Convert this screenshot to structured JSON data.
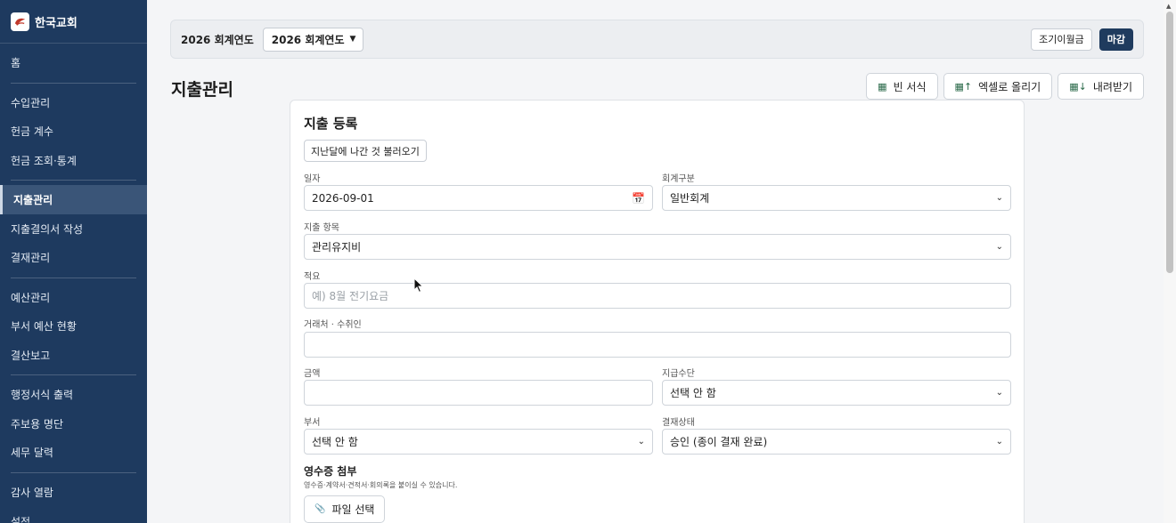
{
  "brand": {
    "name": "한국교회"
  },
  "sidebar": {
    "items": [
      {
        "label": "홈"
      },
      {
        "label": "수입관리"
      },
      {
        "label": "헌금 계수"
      },
      {
        "label": "헌금 조회·통계"
      },
      {
        "label": "지출관리",
        "active": true
      },
      {
        "label": "지출결의서 작성"
      },
      {
        "label": "결재관리"
      },
      {
        "label": "예산관리"
      },
      {
        "label": "부서 예산 현황"
      },
      {
        "label": "결산보고"
      },
      {
        "label": "행정서식 출력"
      },
      {
        "label": "주보용 명단"
      },
      {
        "label": "세무 달력"
      },
      {
        "label": "감사 열람"
      },
      {
        "label": "설정"
      }
    ]
  },
  "topbar": {
    "fiscal_label": "2026 회계연도",
    "fiscal_select_value": "2026 회계연도",
    "early_btn": "조기이월금",
    "close_btn": "마감"
  },
  "page": {
    "title": "지출관리"
  },
  "actions": {
    "blank": "빈 서식",
    "upload": "엑셀로 올리기",
    "download": "내려받기"
  },
  "form": {
    "title": "지출 등록",
    "load_last_month": "지난달에 나간 것 불러오기",
    "date_label": "일자",
    "date_value": "2026-09-01",
    "account_label": "회계구분",
    "account_value": "일반회계",
    "item_label": "지출 항목",
    "item_value": "관리유지비",
    "memo_label": "적요",
    "memo_placeholder": "예) 8월 전기요금",
    "payee_label": "거래처 · 수취인",
    "payee_value": "",
    "amount_label": "금액",
    "amount_value": "",
    "method_label": "지급수단",
    "method_value": "선택 안 함",
    "dept_label": "부서",
    "dept_value": "선택 안 함",
    "approval_label": "결재상태",
    "approval_value": "승인 (종이 결재 완료)",
    "receipt_title": "영수증 첨부",
    "receipt_desc": "영수증·계약서·견적서·회의록을 붙이실 수 있습니다.",
    "file_btn": "파일 선택"
  },
  "colors": {
    "sidebar": "#1e3a5f",
    "accent": "#1f3b5e"
  }
}
